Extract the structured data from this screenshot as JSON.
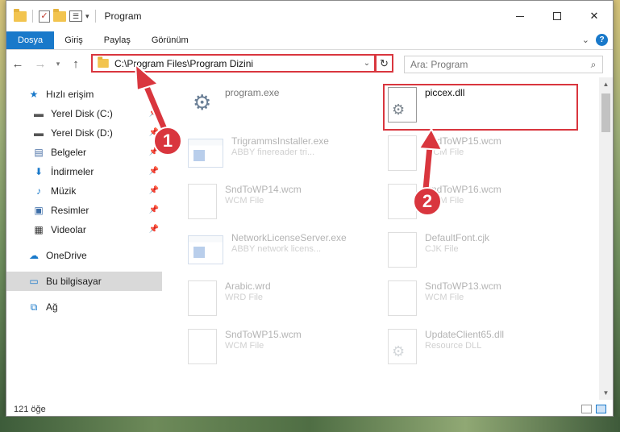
{
  "window": {
    "title": "Program"
  },
  "ribbon": {
    "tabs": [
      "Dosya",
      "Giriş",
      "Paylaş",
      "Görünüm"
    ]
  },
  "address": {
    "path": "C:\\Program Files\\Program Dizini"
  },
  "search": {
    "placeholder": "Ara: Program"
  },
  "sidebar": {
    "quick_access": "Hızlı erişim",
    "items": [
      {
        "label": "Yerel Disk (C:)",
        "icon": "drive-icon"
      },
      {
        "label": "Yerel Disk (D:)",
        "icon": "drive-icon"
      },
      {
        "label": "Belgeler",
        "icon": "document-icon"
      },
      {
        "label": "İndirmeler",
        "icon": "download-icon"
      },
      {
        "label": "Müzik",
        "icon": "music-icon"
      },
      {
        "label": "Resimler",
        "icon": "pictures-icon"
      },
      {
        "label": "Videolar",
        "icon": "video-icon"
      }
    ],
    "onedrive": "OneDrive",
    "this_pc": "Bu bilgisayar",
    "network": "Ağ"
  },
  "files": [
    {
      "name": "program.exe",
      "type": "",
      "icon": "exe",
      "highlight": false
    },
    {
      "name": "piccex.dll",
      "type": "",
      "icon": "gear",
      "highlight": true
    },
    {
      "name": "TrigrammsInstaller.exe",
      "type": "ABBY finereader tri...",
      "icon": "app"
    },
    {
      "name": "SndToWP15.wcm",
      "type": "WCM File",
      "icon": "doc"
    },
    {
      "name": "SndToWP14.wcm",
      "type": "WCM File",
      "icon": "doc"
    },
    {
      "name": "SndToWP16.wcm",
      "type": "WCM File",
      "icon": "doc"
    },
    {
      "name": "NetworkLicenseServer.exe",
      "type": "ABBY network licens...",
      "icon": "app"
    },
    {
      "name": "DefaultFont.cjk",
      "type": "CJK File",
      "icon": "doc"
    },
    {
      "name": "Arabic.wrd",
      "type": "WRD File",
      "icon": "doc"
    },
    {
      "name": "SndToWP13.wcm",
      "type": "WCM File",
      "icon": "doc"
    },
    {
      "name": "SndToWP15.wcm",
      "type": "WCM File",
      "icon": "doc"
    },
    {
      "name": "UpdateClient65.dll",
      "type": "Resource DLL",
      "icon": "gear"
    }
  ],
  "status": {
    "count": "121 öğe"
  },
  "callouts": [
    "1",
    "2"
  ],
  "colors": {
    "accent": "#1979ca",
    "highlight": "#d9363e"
  }
}
